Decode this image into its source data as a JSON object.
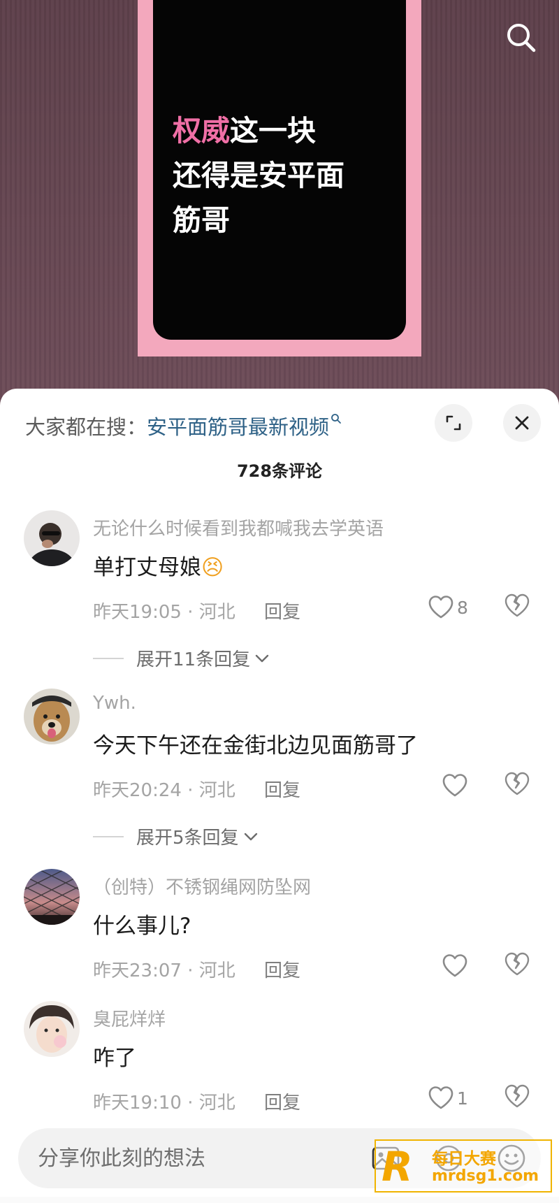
{
  "video": {
    "caption_highlight": "权威",
    "caption_line1_rest": "这一块",
    "caption_line2": "还得是安平面",
    "caption_line3": "筋哥"
  },
  "top_bar": {
    "search_icon": "search-icon"
  },
  "sheet": {
    "suggest_prefix": "大家都在搜：",
    "suggest_term": "安平面筋哥最新视频",
    "suggest_icon": "search-icon",
    "expand_icon": "expand-icon",
    "close_icon": "close-icon",
    "comment_count": "728条评论"
  },
  "comments": [
    {
      "username": "无论什么时候看到我都喊我去学英语",
      "content": "单打丈母娘",
      "emoji": "😣",
      "time_location": "昨天19:05 · 河北",
      "reply_label": "回复",
      "likes": "8",
      "expand_label": "展开11条回复"
    },
    {
      "username": "Ywh.",
      "content": "今天下午还在金街北边见面筋哥了",
      "time_location": "昨天20:24 · 河北",
      "reply_label": "回复",
      "likes": "",
      "expand_label": "展开5条回复"
    },
    {
      "username": "（创特）不锈钢绳网防坠网",
      "content": "什么事儿?",
      "time_location": "昨天23:07 · 河北",
      "reply_label": "回复",
      "likes": ""
    },
    {
      "username": "臭屁烊烊",
      "content": "咋了",
      "time_location": "昨天19:10 · 河北",
      "reply_label": "回复",
      "likes": "1"
    }
  ],
  "input": {
    "placeholder": "分享你此刻的想法",
    "image_icon": "image-icon",
    "at_icon": "at-icon",
    "emoji_icon": "emoji-icon"
  },
  "watermark": {
    "logo": "R",
    "title": "每日大赛",
    "url": "mrdsg1.com"
  },
  "colors": {
    "highlight_pink": "#f06fa6",
    "frame_pink": "#f3a8bd",
    "link_blue": "#2f6287",
    "watermark_gold": "#f3a600"
  }
}
